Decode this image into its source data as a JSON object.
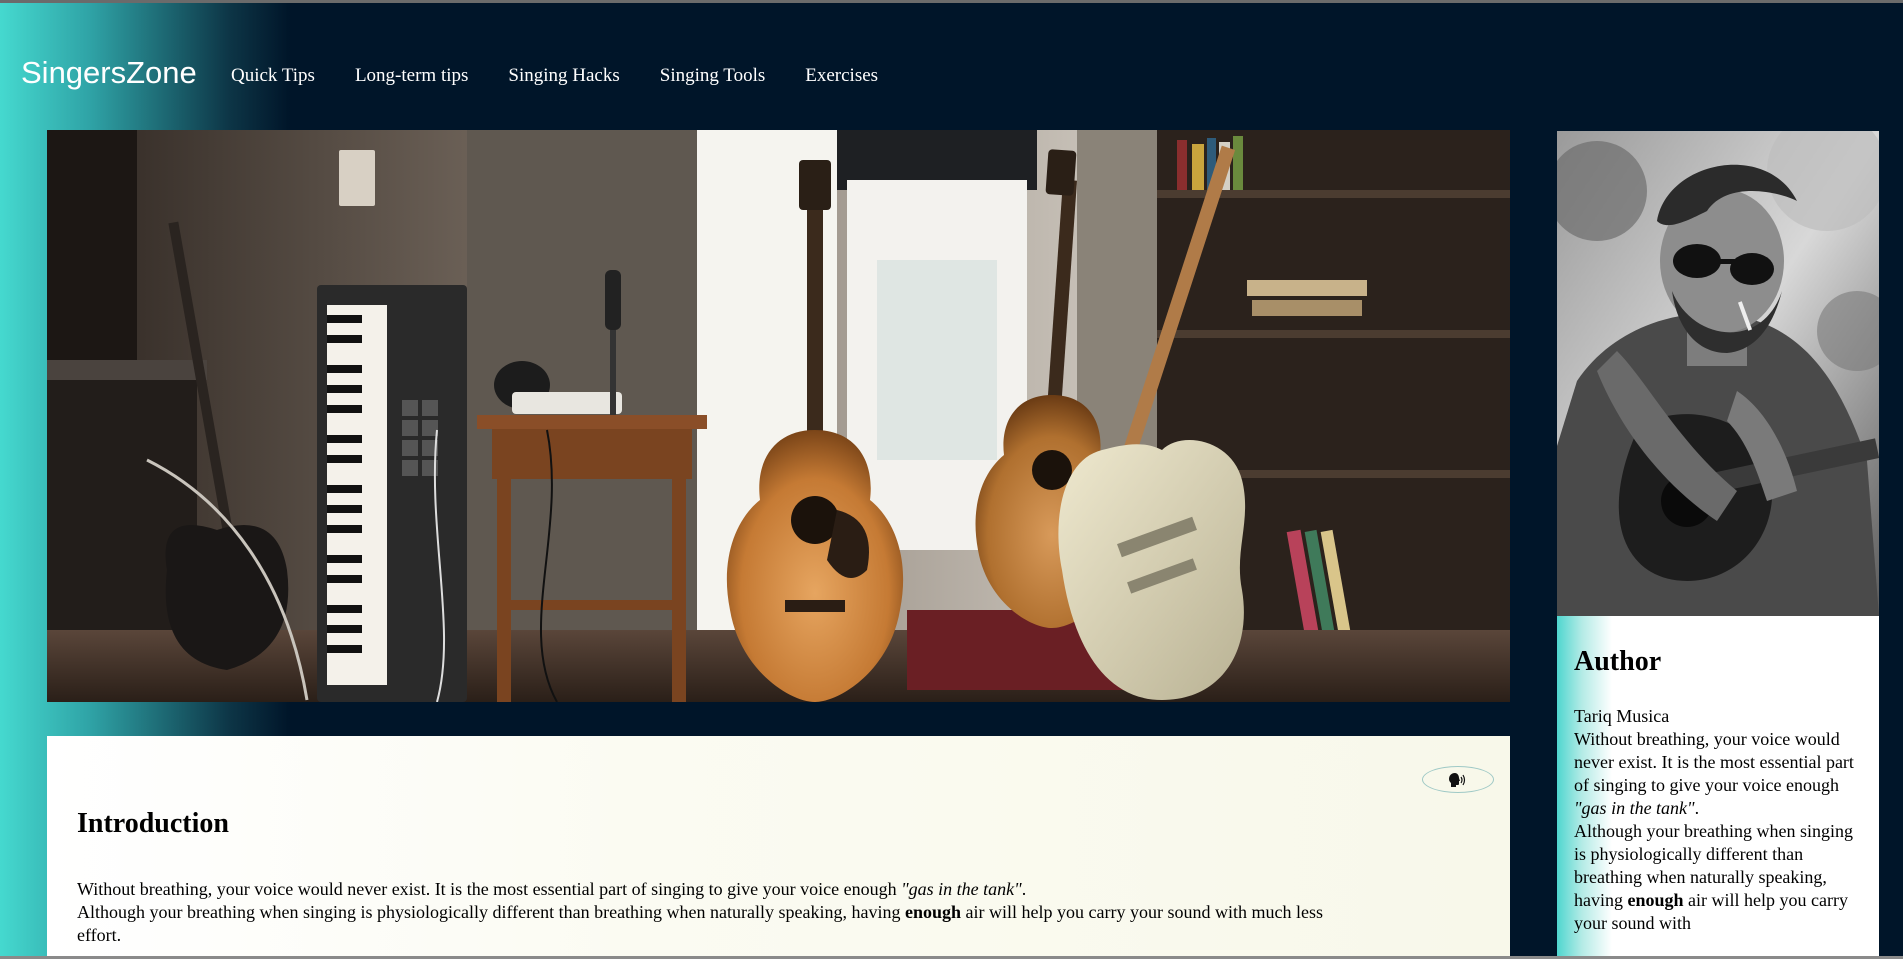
{
  "site": {
    "brand": "SingersZone"
  },
  "nav": {
    "items": [
      {
        "label": "Quick Tips"
      },
      {
        "label": "Long-term tips"
      },
      {
        "label": "Singing Hacks"
      },
      {
        "label": "Singing Tools"
      },
      {
        "label": "Exercises"
      }
    ]
  },
  "hero": {
    "image_subject": "home studio with guitars, keyboard and microphone"
  },
  "intro": {
    "heading": "Introduction",
    "p1_text": "Without breathing, your voice would never exist. It is the most essential part of singing to give your voice enough ",
    "p1_quote": "\"gas in the tank\"",
    "p1_end": ".",
    "p2_start": "Although your breathing when singing is physiologically different than breathing when naturally speaking, having ",
    "p2_bold": "enough",
    "p2_end": " air will help you carry your sound with much less effort.",
    "audio_icon": "speaker-head-icon"
  },
  "author": {
    "heading": "Author",
    "name": "Tariq Musica",
    "p1_text": "Without breathing, your voice would never exist. It is the most essential part of singing to give your voice enough ",
    "p1_quote": "\"gas in the tank\"",
    "p1_end": ".",
    "p2_start": "Although your breathing when singing is physiologically different than breathing when naturally speaking, having ",
    "p2_bold": "enough",
    "p2_end": " air will help you carry your sound with",
    "photo_subject": "man with sunglasses playing acoustic guitar"
  },
  "colors": {
    "navy": "#001529",
    "teal": "#45d9cf",
    "card_bg": "#fbfbf2"
  }
}
